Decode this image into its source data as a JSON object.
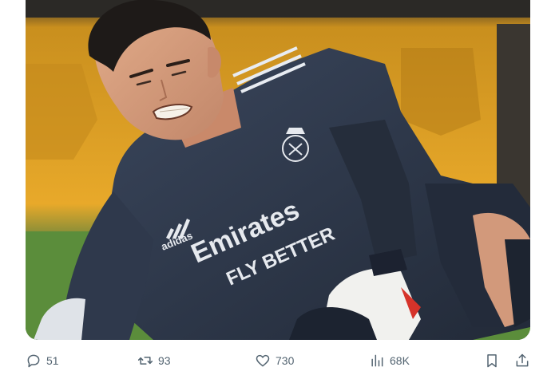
{
  "tweet": {
    "media": {
      "jersey_sponsor_line1": "Emirates",
      "jersey_sponsor_line2": "FLY BETTER",
      "jersey_brand": "adidas"
    },
    "actions": {
      "replies": "51",
      "retweets": "93",
      "likes": "730",
      "views": "68K"
    }
  },
  "colors": {
    "icon_gray": "#536471",
    "background_yellow": "#e8a92a",
    "jersey_navy": "#2b3547",
    "grass_green": "#5a8a3a"
  },
  "icons": [
    "reply-icon",
    "retweet-icon",
    "like-icon",
    "views-icon",
    "bookmark-icon",
    "share-icon"
  ]
}
